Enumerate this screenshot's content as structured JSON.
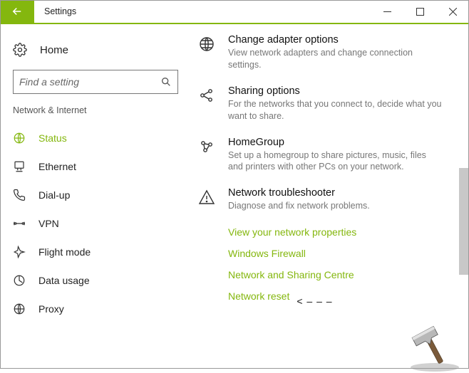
{
  "window": {
    "title": "Settings"
  },
  "sidebar": {
    "home": "Home",
    "search_placeholder": "Find a setting",
    "section": "Network & Internet",
    "items": [
      {
        "label": "Status"
      },
      {
        "label": "Ethernet"
      },
      {
        "label": "Dial-up"
      },
      {
        "label": "VPN"
      },
      {
        "label": "Flight mode"
      },
      {
        "label": "Data usage"
      },
      {
        "label": "Proxy"
      }
    ]
  },
  "content": {
    "items": [
      {
        "title": "Change adapter options",
        "desc": "View network adapters and change connection settings."
      },
      {
        "title": "Sharing options",
        "desc": "For the networks that you connect to, decide what you want to share."
      },
      {
        "title": "HomeGroup",
        "desc": "Set up a homegroup to share pictures, music, files and printers with other PCs on your network."
      },
      {
        "title": "Network troubleshooter",
        "desc": "Diagnose and fix network problems."
      }
    ],
    "links": [
      "View your network properties",
      "Windows Firewall",
      "Network and Sharing Centre",
      "Network reset"
    ],
    "annotation": "< – – –"
  }
}
